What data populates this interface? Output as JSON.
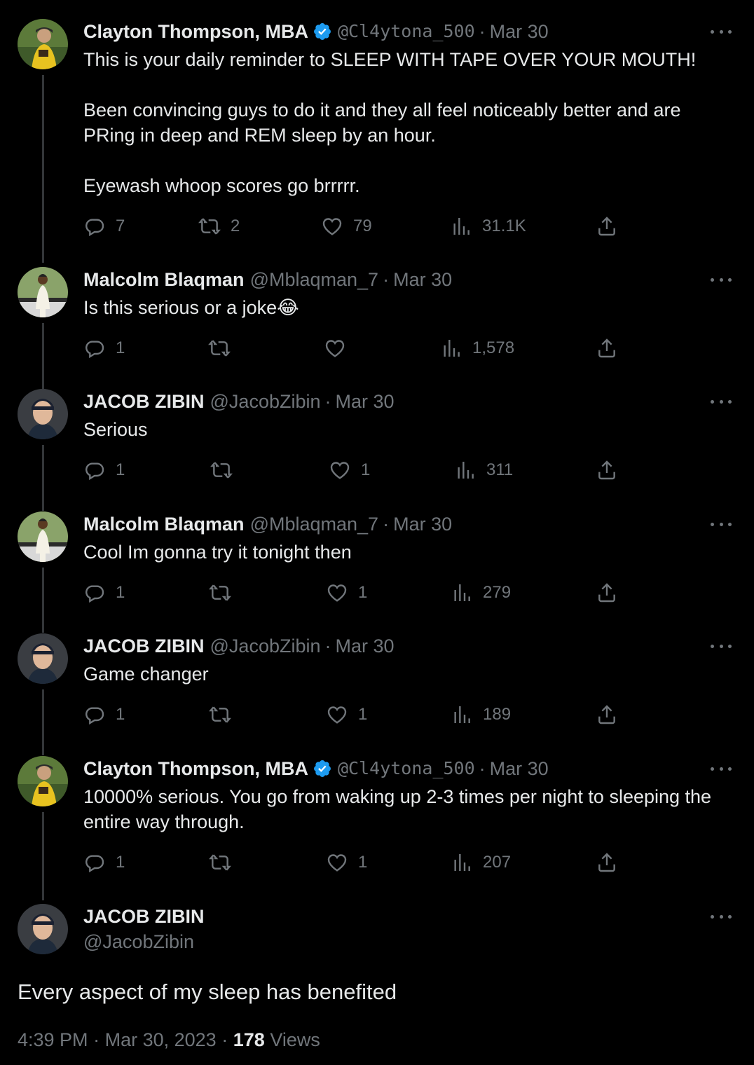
{
  "tweets": [
    {
      "name": "Clayton Thompson, MBA",
      "verified": true,
      "handle": "@Cl4ytona_500",
      "date": "Mar 30",
      "text": "This is your daily reminder to SLEEP WITH TAPE OVER YOUR MOUTH!\n\nBeen convincing guys to do it and they all feel noticeably better and are\nPRing in deep and REM sleep by an hour.\n\nEyewash whoop scores go brrrrr.",
      "replies": "7",
      "retweets": "2",
      "likes": "79",
      "views": "31.1K"
    },
    {
      "name": "Malcolm Blaqman",
      "verified": false,
      "handle": "@Mblaqman_7",
      "date": "Mar 30",
      "text": "Is this serious or a joke😂",
      "replies": "1",
      "retweets": "",
      "likes": "",
      "views": "1,578"
    },
    {
      "name": "JACOB ZIBIN",
      "verified": false,
      "handle": "@JacobZibin",
      "date": "Mar 30",
      "text": "Serious",
      "replies": "1",
      "retweets": "",
      "likes": "1",
      "views": "311"
    },
    {
      "name": "Malcolm Blaqman",
      "verified": false,
      "handle": "@Mblaqman_7",
      "date": "Mar 30",
      "text": "Cool Im gonna try it tonight then",
      "replies": "1",
      "retweets": "",
      "likes": "1",
      "views": "279"
    },
    {
      "name": "JACOB ZIBIN",
      "verified": false,
      "handle": "@JacobZibin",
      "date": "Mar 30",
      "text": "Game changer",
      "replies": "1",
      "retweets": "",
      "likes": "1",
      "views": "189"
    },
    {
      "name": "Clayton Thompson, MBA",
      "verified": true,
      "handle": "@Cl4ytona_500",
      "date": "Mar 30",
      "text": "10000% serious. You go from waking up 2-3 times per night to sleeping the\nentire way through.",
      "replies": "1",
      "retweets": "",
      "likes": "1",
      "views": "207"
    }
  ],
  "main_tweet": {
    "name": "JACOB ZIBIN",
    "handle": "@JacobZibin",
    "text": "Every aspect of my sleep has benefited",
    "time": "4:39 PM",
    "date": "Mar 30, 2023",
    "views_count": "178",
    "views_label": "Views"
  },
  "separator": "·",
  "colors": {
    "background": "#000000",
    "primary_text": "#e7e9ea",
    "secondary_text": "#71767b",
    "verified": "#1d9bf0",
    "thread_line": "#333639"
  },
  "icons": [
    "reply-icon",
    "retweet-icon",
    "like-icon",
    "views-icon",
    "share-icon",
    "more-icon",
    "verified-badge-icon"
  ]
}
